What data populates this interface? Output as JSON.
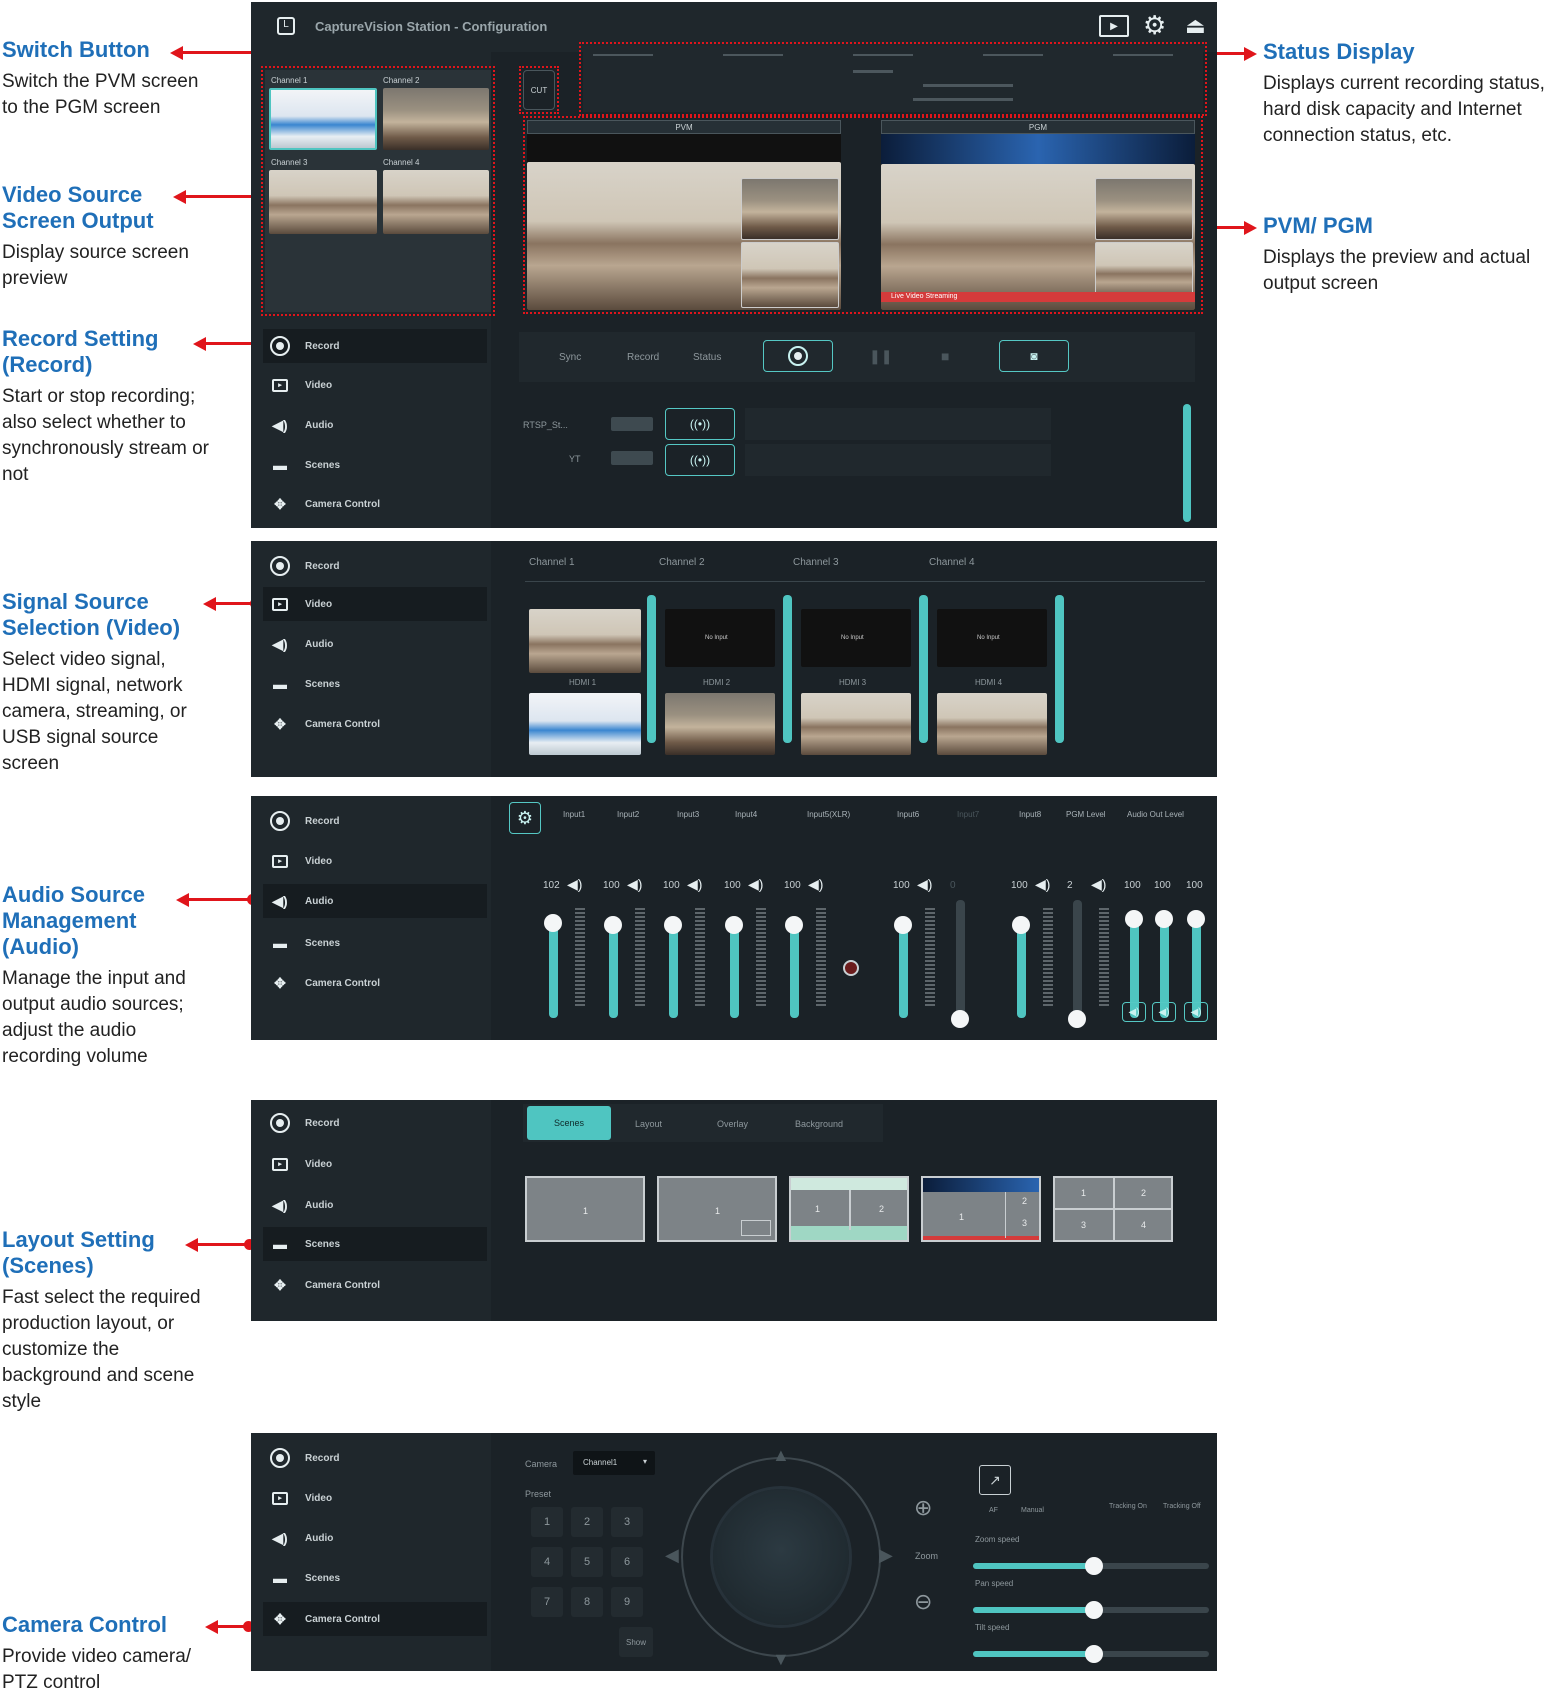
{
  "annotations": {
    "switch": {
      "title": "Switch Button",
      "desc": "Switch the PVM screen to the PGM screen"
    },
    "video_source": {
      "title": "Video Source Screen Output",
      "desc": "Display source screen preview"
    },
    "record": {
      "title": "Record Setting (Record)",
      "desc": "Start or stop recording; also select whether to synchronously stream or not"
    },
    "signal": {
      "title": "Signal Source Selection (Video)",
      "desc": "Select video signal, HDMI signal, network camera, streaming, or USB signal source screen"
    },
    "audio": {
      "title": "Audio Source Management (Audio)",
      "desc": "Manage the input and output audio sources; adjust the audio recording volume"
    },
    "layout": {
      "title": "Layout Setting (Scenes)",
      "desc": "Fast select the required production layout, or customize the background and scene style"
    },
    "camera": {
      "title": "Camera Control",
      "desc": "Provide video camera/ PTZ control"
    },
    "status": {
      "title": "Status Display",
      "desc": "Displays current recording status, hard disk capacity and Internet connection status, etc."
    },
    "pvmpgm": {
      "title": "PVM/ PGM",
      "desc": "Displays the preview and actual output screen"
    }
  },
  "app": {
    "title": "CaptureVision Station - Configuration"
  },
  "nav": {
    "record": "Record",
    "video": "Video",
    "audio": "Audio",
    "scenes": "Scenes",
    "camera": "Camera Control"
  },
  "main": {
    "switch_label": "CUT",
    "pvm": "PVM",
    "pgm": "PGM",
    "live_banner": "Live Video Streaming",
    "sources": [
      "Channel 1",
      "Channel 2",
      "Channel 3",
      "Channel 4"
    ],
    "rec_tabs": [
      "Sync",
      "Record",
      "Status"
    ],
    "stream_rows": [
      "RTSP_St...",
      "YT"
    ]
  },
  "video_panel": {
    "channels": [
      "Channel 1",
      "Channel 2",
      "Channel 3",
      "Channel 4"
    ],
    "inputs": [
      "HDMI 1",
      "HDMI 2",
      "HDMI 3",
      "HDMI 4"
    ],
    "no_input": "No Input"
  },
  "audio_panel": {
    "headers": [
      "Input1",
      "Input2",
      "Input3",
      "Input4",
      "Input5(XLR)",
      "Input6",
      "Input7",
      "Input8",
      "PGM Level",
      "Audio Out Level"
    ],
    "levels": [
      "102",
      "100",
      "100",
      "100",
      "100",
      "100",
      "0",
      "100",
      "2",
      "100",
      "100",
      "100"
    ]
  },
  "scenes_panel": {
    "tabs": [
      "Scenes",
      "Layout",
      "Overlay",
      "Background"
    ]
  },
  "camera_panel": {
    "camera_label": "Camera",
    "camera_value": "Channel1",
    "preset_label": "Preset",
    "keys": [
      "1",
      "2",
      "3",
      "4",
      "5",
      "6",
      "7",
      "8",
      "9"
    ],
    "show": "Show",
    "zoom": "Zoom",
    "af": "AF",
    "modes": [
      "AF",
      "Manual",
      "Tracking On",
      "Tracking Off"
    ],
    "speeds": [
      "Zoom speed",
      "Pan speed",
      "Tilt speed"
    ]
  }
}
